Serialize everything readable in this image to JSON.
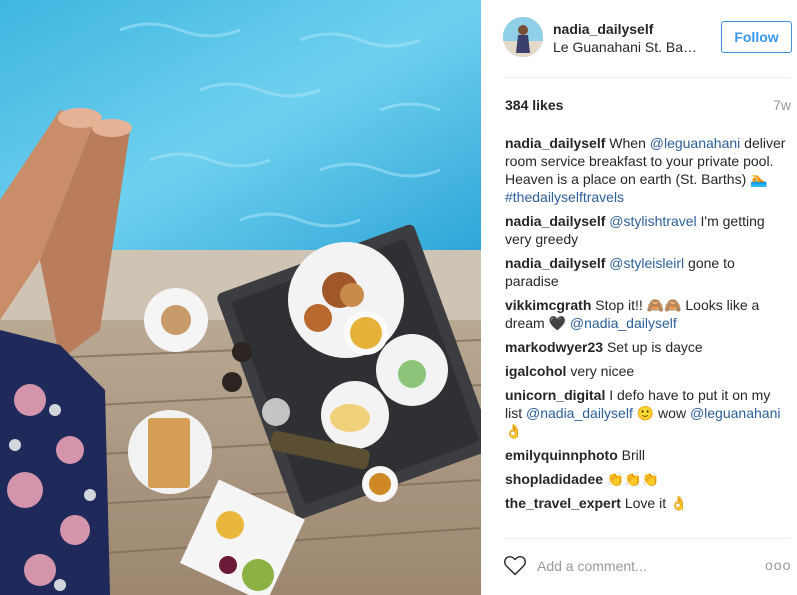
{
  "post": {
    "username": "nadia_dailyself",
    "location": "Le Guanahani St. Barths",
    "follow_label": "Follow",
    "likes": "384 likes",
    "time": "7w"
  },
  "comments": [
    {
      "author": "nadia_dailyself",
      "parts": [
        {
          "t": "text",
          "v": " When "
        },
        {
          "t": "link",
          "v": "@leguanahani"
        },
        {
          "t": "text",
          "v": " deliver room service breakfast to your private pool. Heaven is a place on earth (St. Barths) 🏊 "
        },
        {
          "t": "link",
          "v": "#thedailyselftravels"
        }
      ]
    },
    {
      "author": "nadia_dailyself",
      "parts": [
        {
          "t": "text",
          "v": " "
        },
        {
          "t": "link",
          "v": "@stylishtravel"
        },
        {
          "t": "text",
          "v": " I'm getting very greedy"
        }
      ]
    },
    {
      "author": "nadia_dailyself",
      "parts": [
        {
          "t": "text",
          "v": " "
        },
        {
          "t": "link",
          "v": "@styleisleirl"
        },
        {
          "t": "text",
          "v": " gone to paradise"
        }
      ]
    },
    {
      "author": "vikkimcgrath",
      "parts": [
        {
          "t": "text",
          "v": " Stop it!! 🙈🙈 Looks like a dream 🖤 "
        },
        {
          "t": "link",
          "v": "@nadia_dailyself"
        }
      ]
    },
    {
      "author": "markodwyer23",
      "parts": [
        {
          "t": "text",
          "v": " Set up is dayce"
        }
      ]
    },
    {
      "author": "igalcohol",
      "parts": [
        {
          "t": "text",
          "v": " very nicee"
        }
      ]
    },
    {
      "author": "unicorn_digital",
      "parts": [
        {
          "t": "text",
          "v": " I defo have to put it on my list "
        },
        {
          "t": "link",
          "v": "@nadia_dailyself"
        },
        {
          "t": "text",
          "v": " 🙂 wow "
        },
        {
          "t": "link",
          "v": "@leguanahani"
        },
        {
          "t": "text",
          "v": " 👌"
        }
      ]
    },
    {
      "author": "emilyquinnphoto",
      "parts": [
        {
          "t": "text",
          "v": " Brill"
        }
      ]
    },
    {
      "author": "shopladidadee",
      "parts": [
        {
          "t": "text",
          "v": " 👏👏👏"
        }
      ]
    },
    {
      "author": "the_travel_expert",
      "parts": [
        {
          "t": "text",
          "v": " Love it 👌"
        }
      ]
    }
  ],
  "footer": {
    "comment_placeholder": "Add a comment...",
    "more_label": "ooo"
  },
  "icons": {
    "like": "heart-outline-icon",
    "more": "more-options-icon"
  },
  "colors": {
    "follow_blue": "#3897f0",
    "link_blue": "#2b5f9a",
    "muted": "#999999",
    "text": "#262626"
  }
}
